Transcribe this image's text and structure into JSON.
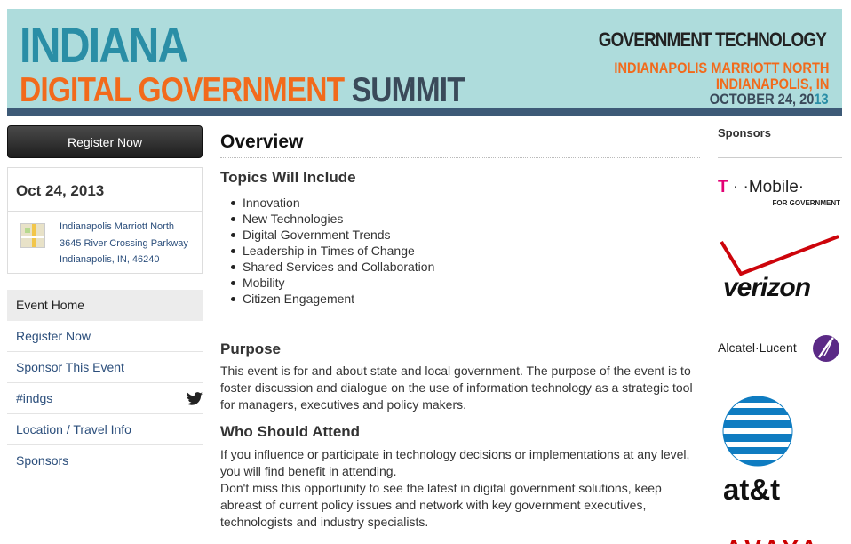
{
  "banner": {
    "title_line1": "INDIANA",
    "title_line2_a": "DIGITAL GOVERNMENT",
    "title_line2_b": "SUMMIT",
    "publisher": "GOVERNMENT TECHNOLOGY",
    "venue_line1": "INDIANAPOLIS MARRIOTT NORTH",
    "venue_line2": "INDIANAPOLIS, IN",
    "date_main": "OCTOBER 24, 20",
    "date_highlight": "13",
    "colors": {
      "teal": "#2a8ea6",
      "orange": "#f26a1b",
      "navy": "#3a4a5a",
      "background": "#aedcdc",
      "bar": "#3d5a77"
    }
  },
  "sidebar": {
    "register_button": "Register Now",
    "event_date": "Oct 24, 2013",
    "address": [
      "Indianapolis Marriott North",
      "3645 River Crossing Parkway",
      "Indianapolis, IN, 46240"
    ],
    "nav": [
      {
        "label": "Event Home",
        "active": true
      },
      {
        "label": "Register Now"
      },
      {
        "label": "Sponsor This Event"
      },
      {
        "label": "#indgs",
        "icon": "twitter-icon"
      },
      {
        "label": "Location / Travel Info"
      },
      {
        "label": "Sponsors"
      }
    ]
  },
  "main": {
    "heading": "Overview",
    "topics_heading": "Topics Will Include",
    "topics": [
      "Innovation",
      "New Technologies",
      "Digital Government Trends",
      "Leadership in Times of Change",
      "Shared Services and Collaboration",
      "Mobility",
      "Citizen Engagement"
    ],
    "purpose_heading": "Purpose",
    "purpose_text": "This event is for and about state and local government. The purpose of the event is to foster discussion and dialogue on the use of information technology as a strategic tool for managers, executives and policy makers.",
    "attend_heading": "Who Should Attend",
    "attend_text_1": "If you influence or participate in technology decisions or implementations at any level, you will find benefit in attending.",
    "attend_text_2": "Don't miss this opportunity to see the latest in digital government solutions, keep abreast of current policy issues and network with key government executives, technologists and industry specialists."
  },
  "sponsors": {
    "title": "Sponsors",
    "tmobile_a": "T",
    "tmobile_b": " · ·Mobile·",
    "tmobile_sub": "FOR GOVERNMENT",
    "verizon": "verizon",
    "alcatel": "Alcatel·Lucent",
    "att": "at&t",
    "avaya": "AVAYA"
  }
}
